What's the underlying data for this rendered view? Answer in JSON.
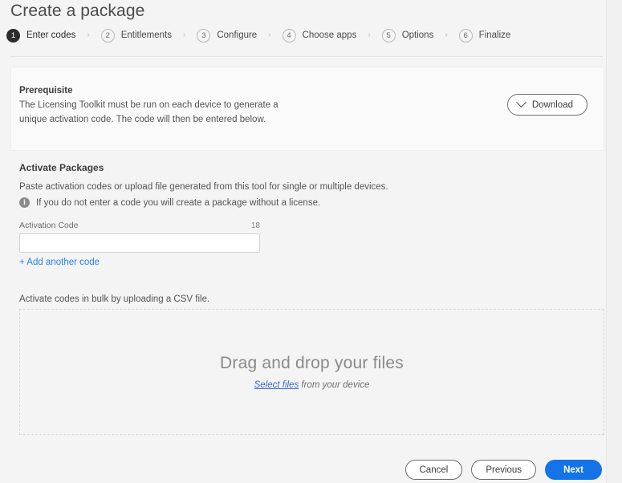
{
  "header": {
    "title": "Create a package",
    "steps": [
      {
        "num": "1",
        "label": "Enter codes",
        "active": true
      },
      {
        "num": "2",
        "label": "Entitlements",
        "active": false
      },
      {
        "num": "3",
        "label": "Configure",
        "active": false
      },
      {
        "num": "4",
        "label": "Choose apps",
        "active": false
      },
      {
        "num": "5",
        "label": "Options",
        "active": false
      },
      {
        "num": "6",
        "label": "Finalize",
        "active": false
      }
    ],
    "separator": "›"
  },
  "prerequisite": {
    "title": "Prerequisite",
    "body": "The Licensing Toolkit must be run on each device to generate a unique activation code. The code will then be entered below.",
    "download_label": "Download",
    "download_icon": "chevron-down-icon"
  },
  "activate": {
    "section_title": "Activate Packages",
    "subtitle": "Paste activation codes or upload file generated from this tool for single or multiple devices.",
    "note_icon": "info-icon",
    "note_glyph": "i",
    "note": "If you do not enter a code you will create a package without a license.",
    "field_label": "Activation Code",
    "field_counter": "18",
    "field_value": "",
    "field_placeholder": "",
    "add_code_label": "+ Add another code"
  },
  "bulk": {
    "label": "Activate codes in bulk by uploading a CSV file.",
    "dropzone_title": "Drag and drop your files",
    "dropzone_link": "Select files",
    "dropzone_suffix": " from your device"
  },
  "footer": {
    "cancel_label": "Cancel",
    "previous_label": "Previous",
    "next_label": "Next"
  },
  "colors": {
    "accent_blue": "#1473e6",
    "link_blue": "#2680eb",
    "page_bg": "#f4f4f4",
    "card_bg": "#fafafa",
    "text": "#4b4b4b"
  }
}
